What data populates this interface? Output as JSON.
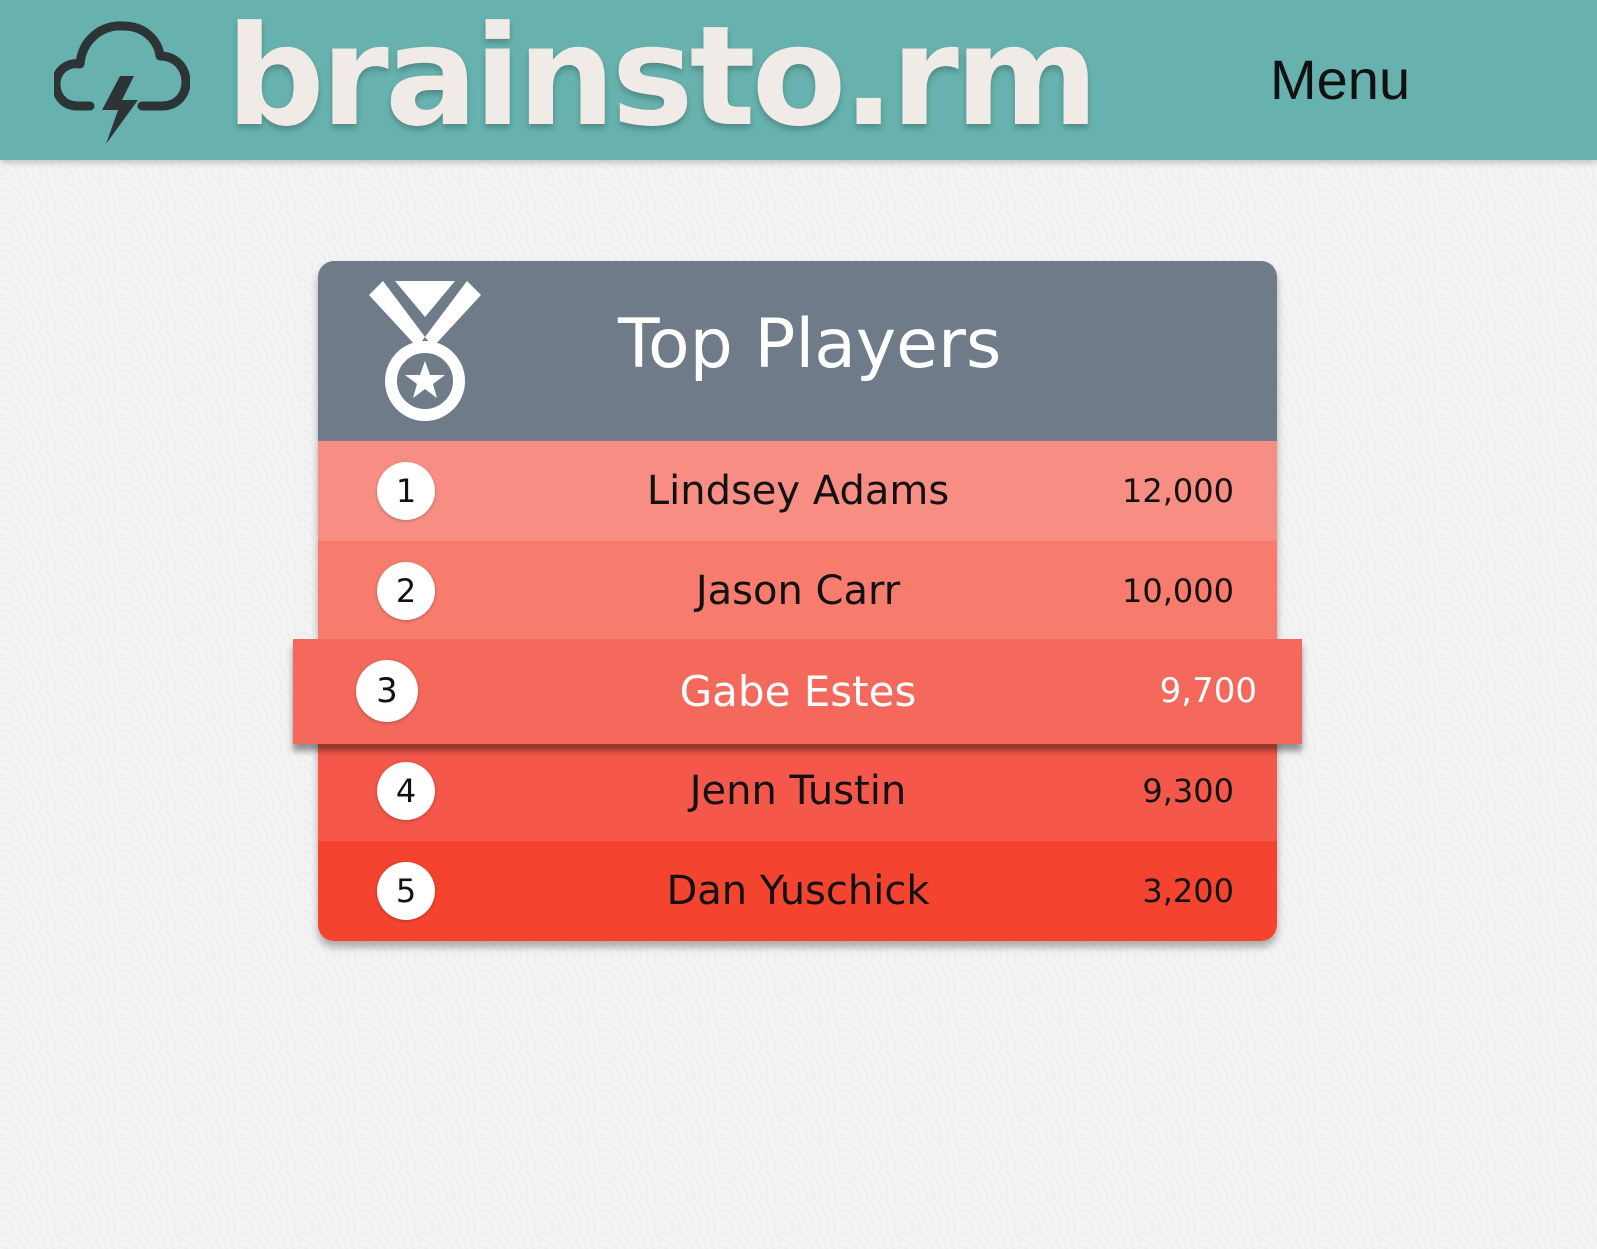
{
  "header": {
    "brand": "brainsto.rm",
    "logo_icon": "storm-cloud-icon",
    "menu_label": "Menu",
    "background_color": "#67b2ae"
  },
  "leaderboard": {
    "title": "Top Players",
    "icon": "medal-icon",
    "header_color": "#6f7b88",
    "highlighted_rank": "3",
    "players": [
      {
        "rank": "1",
        "name": "Lindsey Adams",
        "score": "12,000",
        "color": "#f88e83"
      },
      {
        "rank": "2",
        "name": "Jason Carr",
        "score": "10,000",
        "color": "#f77c6e"
      },
      {
        "rank": "3",
        "name": "Gabe Estes",
        "score": "9,700",
        "color": "#f4695b"
      },
      {
        "rank": "4",
        "name": "Jenn Tustin",
        "score": "9,300",
        "color": "#f5574a"
      },
      {
        "rank": "5",
        "name": "Dan Yuschick",
        "score": "3,200",
        "color": "#f4432f"
      }
    ]
  }
}
